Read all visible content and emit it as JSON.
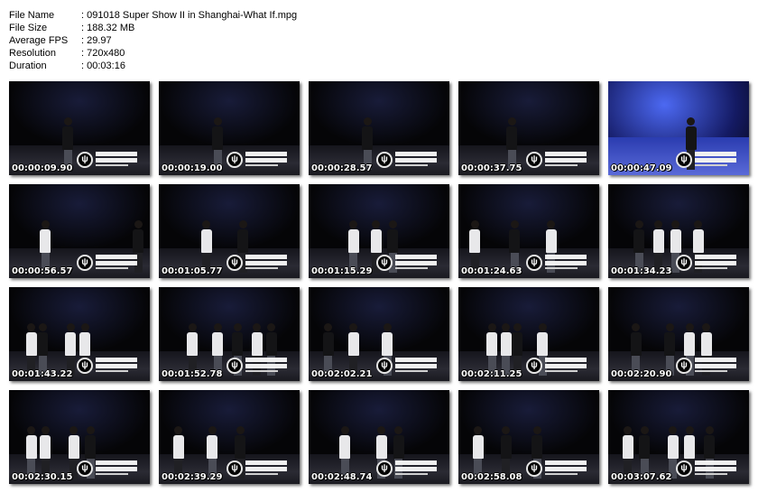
{
  "info": [
    {
      "label": "File Name",
      "value": ": 091018 Super Show II in Shanghai-What If.mpg"
    },
    {
      "label": "File Size",
      "value": ": 188.32 MB"
    },
    {
      "label": "Average FPS",
      "value": ": 29.97"
    },
    {
      "label": "Resolution",
      "value": ": 720x480"
    },
    {
      "label": "Duration",
      "value": ": 00:03:16"
    }
  ],
  "thumbnails": [
    {
      "time": "00:00:09.90"
    },
    {
      "time": "00:00:19.00"
    },
    {
      "time": "00:00:28.57"
    },
    {
      "time": "00:00:37.75"
    },
    {
      "time": "00:00:47.09"
    },
    {
      "time": "00:00:56.57"
    },
    {
      "time": "00:01:05.77"
    },
    {
      "time": "00:01:15.29"
    },
    {
      "time": "00:01:24.63"
    },
    {
      "time": "00:01:34.23"
    },
    {
      "time": "00:01:43.22"
    },
    {
      "time": "00:01:52.78"
    },
    {
      "time": "00:02:02.21"
    },
    {
      "time": "00:02:11.25"
    },
    {
      "time": "00:02:20.90"
    },
    {
      "time": "00:02:30.15"
    },
    {
      "time": "00:02:39.29"
    },
    {
      "time": "00:02:48.74"
    },
    {
      "time": "00:02:58.08"
    },
    {
      "time": "00:03:07.62"
    }
  ]
}
